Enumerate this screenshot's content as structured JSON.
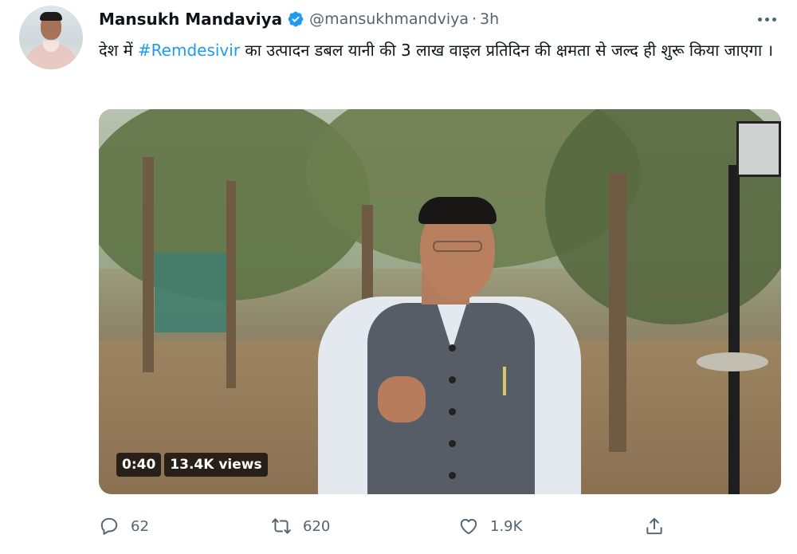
{
  "author": {
    "name": "Mansukh Mandaviya",
    "handle": "@mansukhmandviya",
    "separator": "·",
    "time": "3h",
    "verified": true
  },
  "tweet": {
    "text_before": "देश में ",
    "hashtag": "#Remdesivir",
    "text_after": " का उत्पादन डबल यानी की 3 लाख वाइल प्रतिदिन की क्षमता से जल्द ही शुरू किया जाएगा ।"
  },
  "video": {
    "duration": "0:40",
    "views": "13.4K views"
  },
  "actions": {
    "replies": "62",
    "retweets": "620",
    "likes": "1.9K"
  },
  "colors": {
    "accent": "#1d9bf0",
    "text": "#0f1419",
    "muted": "#536471"
  },
  "icons": [
    "verified-badge-icon",
    "more-options-icon",
    "reply-icon",
    "retweet-icon",
    "like-icon",
    "share-icon"
  ]
}
